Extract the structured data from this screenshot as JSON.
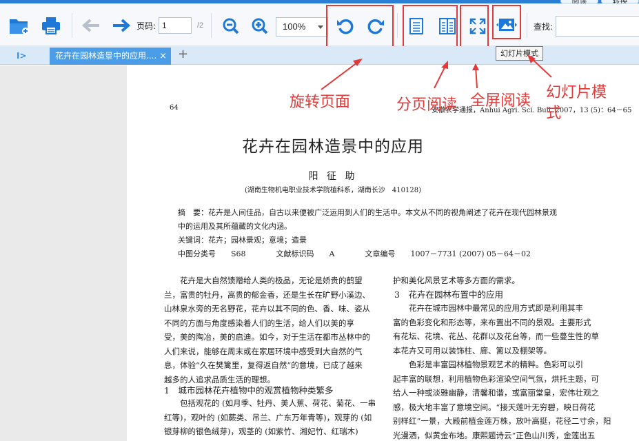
{
  "window": {
    "top_tabs": [
      "阅读",
      "转换"
    ]
  },
  "toolbar": {
    "page_label": "页码:",
    "page_value": "1",
    "page_total": "/2",
    "zoom_value": "100%",
    "find_label": "查找:"
  },
  "tabbar": {
    "doc_tab_title": "花卉在园林造景中的应用....",
    "close_glyph": "×",
    "new_tab_glyph": "+",
    "sidebar_glyph": "I>"
  },
  "tooltip": "幻灯片模式",
  "annotations": {
    "rotate": "旋转页面",
    "pagination": "分页阅读",
    "fullscreen": "全屏阅读",
    "slideshow_line1": "幻灯片模",
    "slideshow_line2": "式"
  },
  "document": {
    "page_number": "64",
    "journal": "安徽农学通报，Anhui Agri. Sci. Bull. 2007，13 (5)：64－65",
    "title": "花卉在园林造景中的应用",
    "author": "阳 征 助",
    "affiliation": "(湖南生物机电职业技术学院植科系，湖南长沙　410128)",
    "abstract_line1": "摘　要：花卉是人间佳品，自古以来便被广泛运用到人们的生活中。本文从不同的视角阐述了花卉在现代园林景观",
    "abstract_line2": "中的运用及其所蕴藏的文化内涵。",
    "keywords": "关键词：花卉；园林景观；意境；造景",
    "classification": "中图分类号　　S68　　　　文献标识码　　A　　　　文章编号　　1007－7731 (2007) 05－64－02",
    "left_col_intro": [
      "　　花卉是大自然馈赠给人类的极品，无论是娇贵的鹤望",
      "兰，富贵的牡丹，高贵的郁金香，还是生长在旷野小溪边、",
      "山林泉水旁的无名野花，花卉以其不同的色、香、味、姿从",
      "不同的方面与角度感染着人们的生活，给人们以美的享",
      "受，美的陶冶，美的启迪。如今，对于生活在都市丛林中的",
      "人们来说，能够在周末或在家居环境中感受到大自然的气",
      "息，体验“久在樊篱里，复得返自然”的意境，已成了越来",
      "越多的人追求品质生活的理想。"
    ],
    "left_heading": "1　城市园林花卉植物中的观赏植物种类繁多",
    "left_col_after": [
      "　　包括观花的 (如月季、牡丹、美人蕉、荷花、菊花、一串",
      "红等)，观叶的 (如蕨类、吊兰、广东万年青等)，观芽的 (如",
      "银芽柳的银色绒芽)，观茎的 (如紫竹、湘妃竹、红瑞木)"
    ],
    "right_col_top": "护和美化风景艺术等多方面的需求。",
    "right_heading": "3　花卉在园林布置中的应用",
    "right_col_body": [
      "　　花卉在城市园林中最常见的应用方式即是利用其丰",
      "富的色彩变化和形态等，来布置出不同的景观。主要形式",
      "有花坛、花境、花丛、花群以及花台等，而一些蔓生性的草",
      "本花卉又可用以装饰柱、廊、篱以及棚架等。",
      "　　色彩是丰富园林植物景观艺术的精粹。色彩可以引",
      "起丰富的联想，利用植物色彩渲染空间气氛，烘托主题，可",
      "给人一种或淡雅幽静，清馨和谐，或富丽堂皇，宏伟壮观之",
      "感，极大地丰富了意境空间。“接天莲叶无穷碧，映日荷花",
      "别样红”一景，大殿前植金莲万株，放叶高挺，花径二寸余，阳",
      "光漫洒，似黄金布地。康熙题诗云“正色山川秀，金莲出五"
    ]
  },
  "colors": {
    "accent_blue": "#2a7fd4",
    "tab_active": "#4a9de6",
    "annotation_red": "#e23a3a",
    "icon_blue": "#1e78d7"
  }
}
